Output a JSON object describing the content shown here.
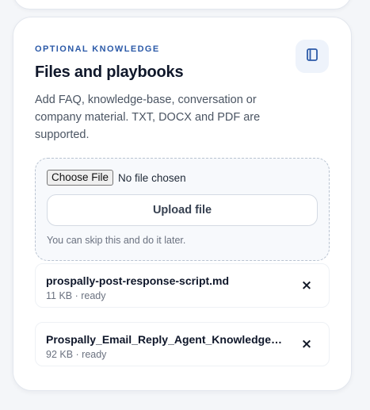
{
  "card": {
    "eyebrow": "OPTIONAL KNOWLEDGE",
    "title": "Files and playbooks",
    "description": "Add FAQ, knowledge-base, conversation or company material. TXT, DOCX and PDF are supported.",
    "icon": "copy-icon"
  },
  "uploader": {
    "choose_label": "Choose File",
    "no_file_text": "No file chosen",
    "upload_label": "Upload file",
    "hint": "You can skip this and do it later."
  },
  "files": [
    {
      "name": "prospally-post-response-script.md",
      "meta": "11 KB · ready",
      "remove_glyph": "×"
    },
    {
      "name": "Prospally_Email_Reply_Agent_Knowledge_Base.docx",
      "meta": "92 KB · ready",
      "remove_glyph": "×"
    }
  ],
  "colors": {
    "accent": "#2c5aa8",
    "page_bg": "#f4f6f9",
    "card_bg": "#ffffff"
  }
}
